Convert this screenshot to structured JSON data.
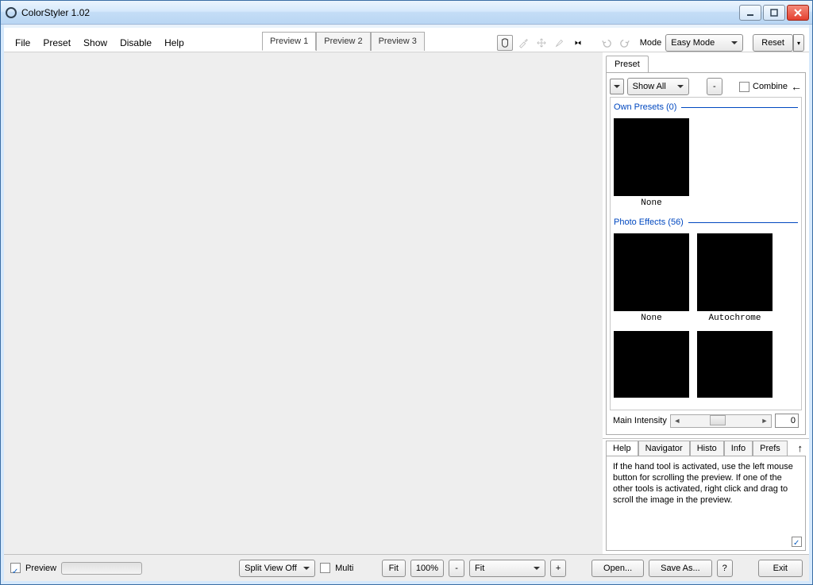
{
  "title": "ColorStyler 1.02",
  "menu": {
    "file": "File",
    "preset": "Preset",
    "show": "Show",
    "disable": "Disable",
    "help": "Help"
  },
  "preview_tabs": {
    "0": "Preview 1",
    "1": "Preview 2",
    "2": "Preview 3"
  },
  "toolbar": {
    "mode_label": "Mode",
    "mode_value": "Easy Mode",
    "reset": "Reset"
  },
  "preset_panel": {
    "tab": "Preset",
    "filter_value": "Show All",
    "collapse_btn": "-",
    "combine": "Combine",
    "groups": [
      {
        "title": "Own Presets (0)",
        "items": [
          {
            "label": "None"
          }
        ]
      },
      {
        "title": "Photo Effects (56)",
        "items": [
          {
            "label": "None"
          },
          {
            "label": "Autochrome"
          },
          {
            "label": ""
          },
          {
            "label": ""
          }
        ]
      }
    ],
    "intensity_label": "Main Intensity",
    "intensity_value": "0"
  },
  "info": {
    "tabs": {
      "help": "Help",
      "navigator": "Navigator",
      "histo": "Histo",
      "info": "Info",
      "prefs": "Prefs"
    },
    "help_text": "If the hand tool is activated, use the left mouse button for scrolling the preview. If one of the other tools is activated, right click and drag to scroll the image in the preview."
  },
  "bottom": {
    "preview": "Preview",
    "splitview": "Split View Off",
    "multi": "Multi",
    "fit": "Fit",
    "zoom": "100%",
    "minus": "-",
    "fit2": "Fit",
    "plus": "+",
    "open": "Open...",
    "saveas": "Save As...",
    "help": "?",
    "exit": "Exit"
  }
}
